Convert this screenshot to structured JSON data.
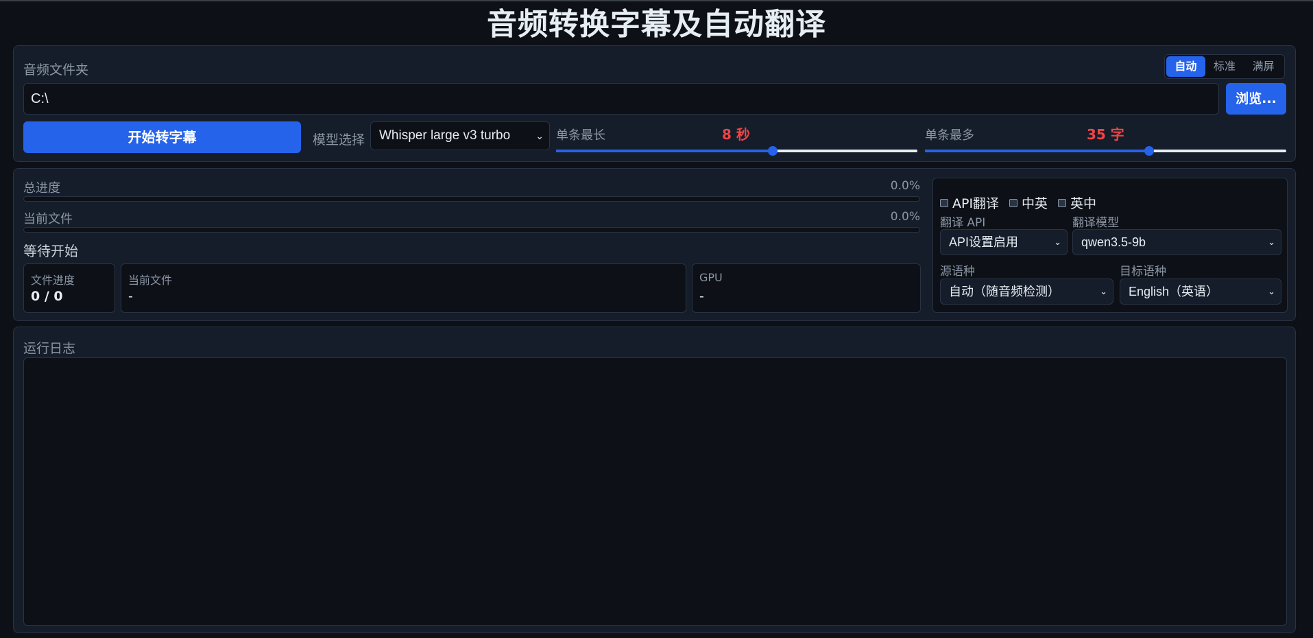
{
  "app": {
    "title": "音频转换字幕及自动翻译"
  },
  "folder": {
    "label": "音频文件夹",
    "path": "C:\\",
    "browse_label": "浏览..."
  },
  "display_modes": {
    "items": [
      "自动",
      "标准",
      "满屏"
    ],
    "active": "自动"
  },
  "controls": {
    "start_label": "开始转字幕",
    "model_label": "模型选择",
    "model_value": "Whisper large v3 turbo",
    "max_duration": {
      "label": "单条最长",
      "value_text": "8 秒",
      "level": 0.6
    },
    "max_chars": {
      "label": "单条最多",
      "value_text": "35 字",
      "level": 0.62
    }
  },
  "progress": {
    "total": {
      "label": "总进度",
      "percent_text": "0.0%",
      "level": 0
    },
    "current": {
      "label": "当前文件",
      "percent_text": "0.0%",
      "level": 0
    },
    "status": "等待开始",
    "file_progress": {
      "label": "文件进度",
      "value": "0 / 0"
    },
    "current_file": {
      "label": "当前文件",
      "value": "-"
    },
    "gpu": {
      "label": "GPU",
      "value": "-"
    }
  },
  "translation": {
    "options": [
      {
        "label": "API翻译",
        "checked": false
      },
      {
        "label": "中英",
        "checked": false
      },
      {
        "label": "英中",
        "checked": false
      }
    ],
    "api": {
      "label": "翻译 API",
      "value": "API设置启用"
    },
    "model": {
      "label": "翻译模型",
      "value": "qwen3.5-9b"
    },
    "source": {
      "label": "源语种",
      "value": "自动（随音频检测）"
    },
    "target": {
      "label": "目标语种",
      "value": "English（英语）"
    }
  },
  "log": {
    "label": "运行日志"
  },
  "colors": {
    "accent": "#2563eb",
    "highlight": "#ef4444",
    "background": "#0d1117",
    "panel": "#161d2a"
  }
}
